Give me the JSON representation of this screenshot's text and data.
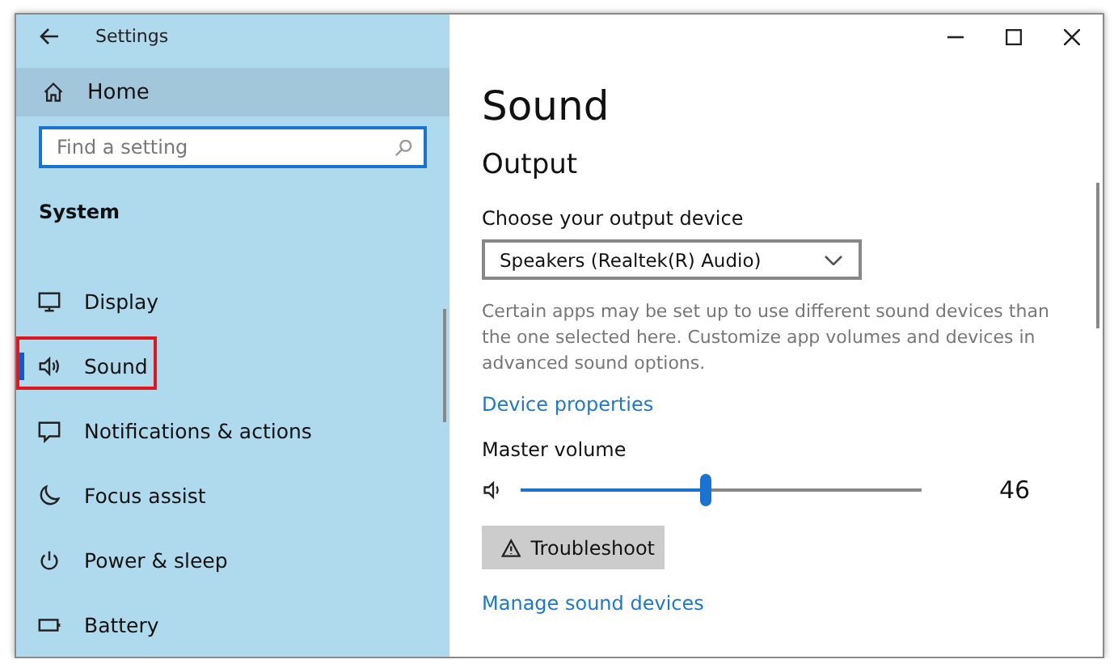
{
  "window": {
    "title": "Settings"
  },
  "sidebar": {
    "home": "Home",
    "search": {
      "placeholder": "Find a setting"
    },
    "section": "System",
    "items": [
      {
        "label": "Display",
        "kind": "display",
        "selected": false,
        "highlighted": false
      },
      {
        "label": "Sound",
        "kind": "sound",
        "selected": true,
        "highlighted": true
      },
      {
        "label": "Notifications & actions",
        "kind": "notifications",
        "selected": false,
        "highlighted": false
      },
      {
        "label": "Focus assist",
        "kind": "focus",
        "selected": false,
        "highlighted": false
      },
      {
        "label": "Power & sleep",
        "kind": "power",
        "selected": false,
        "highlighted": false
      },
      {
        "label": "Battery",
        "kind": "battery",
        "selected": false,
        "highlighted": false
      }
    ]
  },
  "page": {
    "title": "Sound",
    "section": "Output",
    "device_label": "Choose your output device",
    "device_value": "Speakers (Realtek(R) Audio)",
    "note": "Certain apps may be set up to use different sound devices than the one selected here. Customize app volumes and devices in advanced sound options.",
    "device_link": "Device properties",
    "volume_label": "Master volume",
    "volume": {
      "level": 0.46,
      "reading": "46"
    },
    "troubleshoot": "Troubleshoot",
    "manage_link": "Manage sound devices"
  }
}
